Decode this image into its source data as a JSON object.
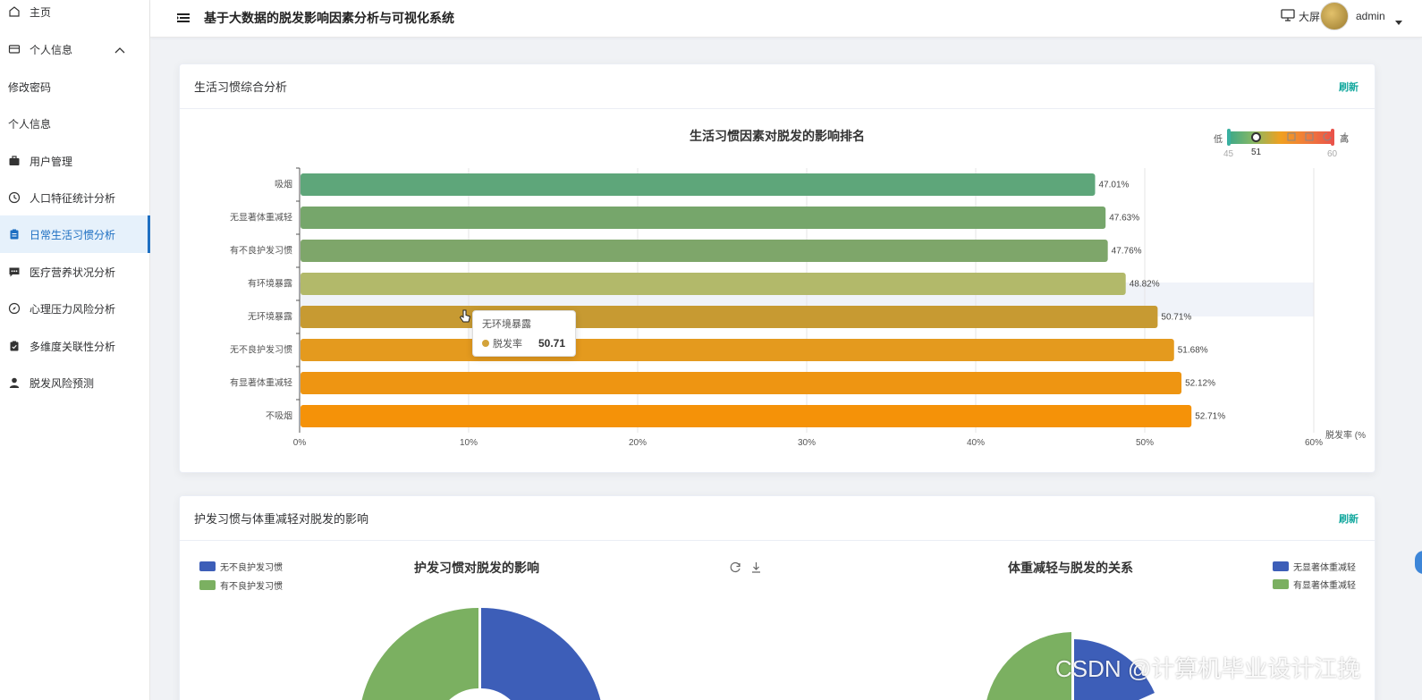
{
  "sidebar": {
    "items": [
      {
        "label": "主页"
      },
      {
        "label": "个人信息"
      },
      {
        "label": "修改密码"
      },
      {
        "label": "个人信息"
      },
      {
        "label": "用户管理"
      },
      {
        "label": "人口特征统计分析"
      },
      {
        "label": "日常生活习惯分析"
      },
      {
        "label": "医疗营养状况分析"
      },
      {
        "label": "心理压力风险分析"
      },
      {
        "label": "多维度关联性分析"
      },
      {
        "label": "脱发风险预测"
      }
    ]
  },
  "header": {
    "title": "基于大数据的脱发影响因素分析与可视化系统",
    "big_screen": "大屏",
    "user": "admin"
  },
  "card1": {
    "title": "生活习惯综合分析",
    "refresh": "刷新"
  },
  "card2": {
    "title": "护发习惯与体重减轻对脱发的影响",
    "refresh": "刷新"
  },
  "visual_map": {
    "low": "低",
    "high": "高",
    "min": "45",
    "max": "60",
    "current": "51"
  },
  "tooltip": {
    "title": "无环境暴露",
    "series": "脱发率",
    "value": "50.71"
  },
  "pie_left": {
    "title": "护发习惯对脱发的影响",
    "legend": [
      "无不良护发习惯",
      "有不良护发习惯"
    ]
  },
  "pie_right": {
    "title": "体重减轻与脱发的关系",
    "legend": [
      "无显著体重减轻",
      "有显著体重减轻"
    ]
  },
  "watermark": "CSDN @计算机毕业设计江挽",
  "chart_data": {
    "type": "bar",
    "orientation": "horizontal",
    "title": "生活习惯因素对脱发的影响排名",
    "xlabel": "脱发率 (%",
    "categories": [
      "吸烟",
      "无显著体重减轻",
      "有不良护发习惯",
      "有环境暴露",
      "无环境暴露",
      "无不良护发习惯",
      "有显著体重减轻",
      "不吸烟"
    ],
    "values": [
      47.01,
      47.63,
      47.76,
      48.82,
      50.71,
      51.68,
      52.12,
      52.71
    ],
    "value_labels": [
      "47.01%",
      "47.63%",
      "47.76%",
      "48.82%",
      "50.71%",
      "51.68%",
      "52.12%",
      "52.71%"
    ],
    "colors": [
      "#5ea67a",
      "#76a66b",
      "#7ea66a",
      "#b2b96a",
      "#c79a32",
      "#e49a1e",
      "#ee9512",
      "#f59208"
    ],
    "xlim": [
      0,
      60
    ],
    "ticks": [
      "0%",
      "10%",
      "20%",
      "30%",
      "40%",
      "50%",
      "60%"
    ],
    "grid": true
  },
  "colors": {
    "accent": "#1e6fc2",
    "refresh": "#13a89e",
    "pie_blue": "#3d5eb8",
    "pie_green": "#7bb061"
  }
}
